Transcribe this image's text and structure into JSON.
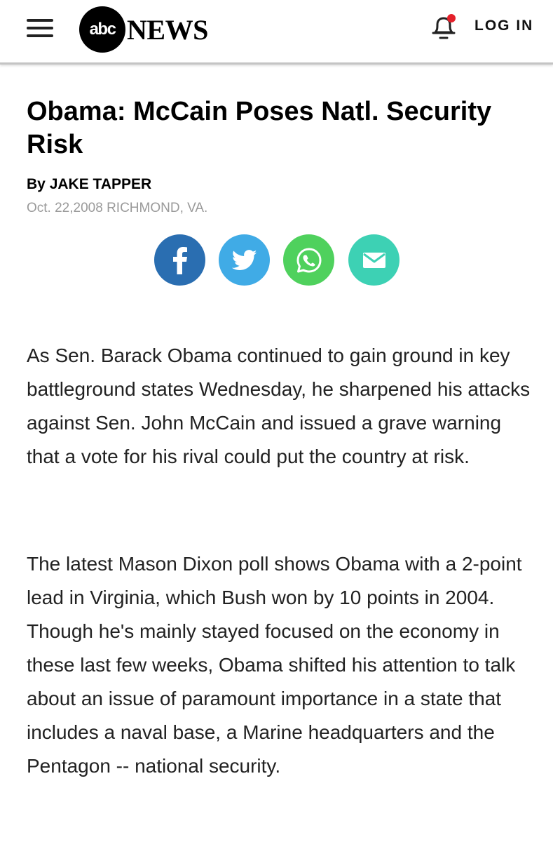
{
  "header": {
    "logo_abc": "abc",
    "logo_news": "NEWS",
    "login_label": "LOG IN",
    "notification_dot_color": "#e4202a"
  },
  "article": {
    "headline": "Obama: McCain Poses Natl. Security Risk",
    "byline_prefix": "By",
    "author": "JAKE TAPPER",
    "dateline": "Oct. 22,2008 RICHMOND, VA."
  },
  "share": [
    {
      "icon": "facebook-icon",
      "color": "#2a6eb1"
    },
    {
      "icon": "twitter-icon",
      "color": "#40abe6"
    },
    {
      "icon": "whatsapp-icon",
      "color": "#4fd15d"
    },
    {
      "icon": "email-icon",
      "color": "#3dd1b4"
    }
  ],
  "body": {
    "paragraph_1": "As Sen. Barack Obama continued to gain ground in key battleground states Wednesday, he sharpened his attacks against Sen. John McCain and issued a grave warning that a vote for his rival could put the country at risk.",
    "paragraph_2": "The latest Mason Dixon poll shows Obama with a 2-point lead in Virginia, which Bush won by 10 points in 2004. Though he's mainly stayed focused on the economy in these last few weeks, Obama shifted his attention to talk about an issue of paramount importance in a state that includes a naval base, a Marine headquarters and the Pentagon -- national security."
  }
}
